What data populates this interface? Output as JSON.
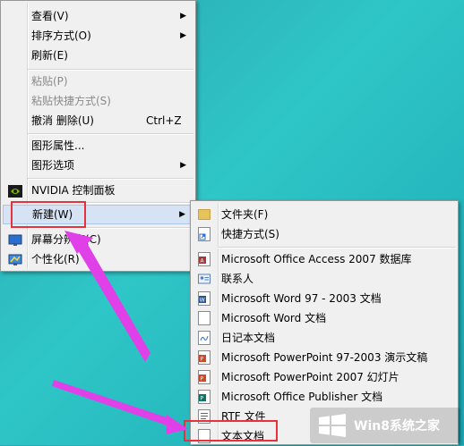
{
  "main_menu": {
    "items": [
      {
        "label": "查看(V)",
        "arrow": true
      },
      {
        "label": "排序方式(O)",
        "arrow": true
      },
      {
        "label": "刷新(E)"
      },
      {
        "label": "粘贴(P)",
        "disabled": true
      },
      {
        "label": "粘贴快捷方式(S)",
        "disabled": true
      },
      {
        "label": "撤消 删除(U)",
        "shortcut": "Ctrl+Z"
      },
      {
        "label": "图形属性..."
      },
      {
        "label": "图形选项",
        "arrow": true
      },
      {
        "label": "NVIDIA 控制面板",
        "icon": "nvidia-icon"
      },
      {
        "label": "新建(W)",
        "arrow": true,
        "highlighted": true
      },
      {
        "label": "屏幕分辨率(C)",
        "icon": "display-icon"
      },
      {
        "label": "个性化(R)",
        "icon": "personalize-icon"
      }
    ]
  },
  "sub_menu": {
    "items": [
      {
        "label": "文件夹(F)",
        "icon": "folder-icon"
      },
      {
        "label": "快捷方式(S)",
        "icon": "shortcut-icon"
      },
      {
        "label": "Microsoft Office Access 2007 数据库",
        "icon": "access-icon"
      },
      {
        "label": "联系人",
        "icon": "contact-icon"
      },
      {
        "label": "Microsoft Word 97 - 2003 文档",
        "icon": "word-icon"
      },
      {
        "label": "Microsoft Word 文档",
        "icon": "word-doc-icon"
      },
      {
        "label": "日记本文档",
        "icon": "journal-icon"
      },
      {
        "label": "Microsoft PowerPoint 97-2003 演示文稿",
        "icon": "powerpoint-icon"
      },
      {
        "label": "Microsoft PowerPoint 2007 幻灯片",
        "icon": "powerpoint-icon"
      },
      {
        "label": "Microsoft Office Publisher 文档",
        "icon": "publisher-icon"
      },
      {
        "label": "RTF 文件",
        "icon": "rtf-icon"
      },
      {
        "label": "文本文档",
        "icon": "text-doc-icon"
      }
    ]
  },
  "watermark": {
    "text": "Win8系统之家"
  },
  "colors": {
    "highlight": "#d5e3f4",
    "annotation": "#e8313a",
    "arrow": "#e040e8",
    "desktop": "#2fc6c7"
  }
}
